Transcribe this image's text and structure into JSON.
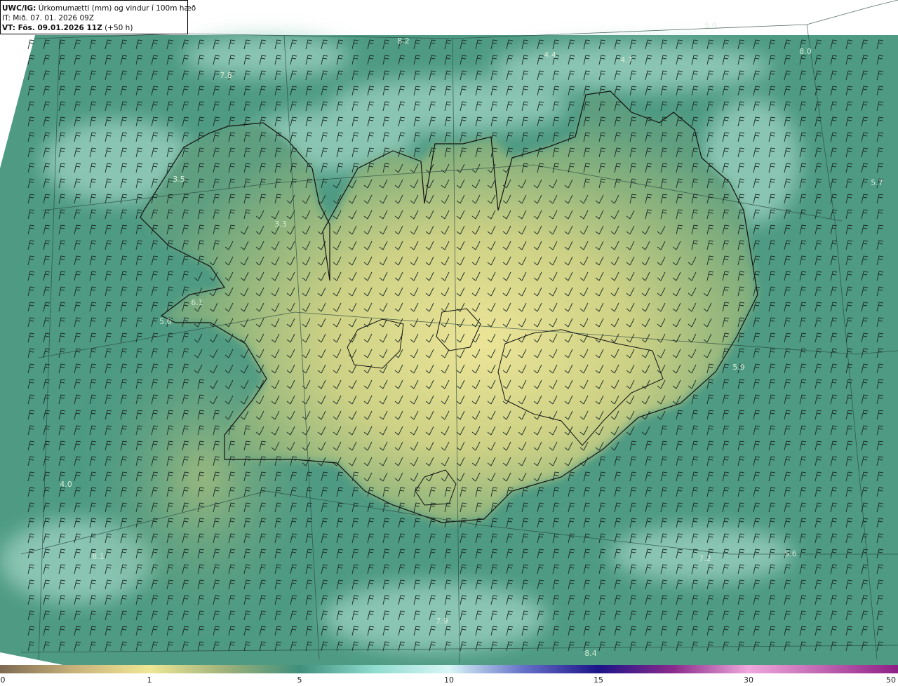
{
  "header": {
    "model_code": "UWC/IG:",
    "title_text": " Úrkomumætti (mm) og vindur í 100m hæð",
    "init_time": "IT: Mið. 07. 01. 2026 09Z",
    "valid_label": "VT: Fös. 09.01.2026 11Z",
    "valid_offset": " (+50 h)"
  },
  "map_labels": [
    {
      "text": "5.0"
    },
    {
      "text": "8.2"
    },
    {
      "text": "4.4"
    },
    {
      "text": "4.7"
    },
    {
      "text": "8.0"
    },
    {
      "text": "7.8"
    },
    {
      "text": "3.5"
    },
    {
      "text": "3.3"
    },
    {
      "text": "5.7"
    },
    {
      "text": "6.1"
    },
    {
      "text": "5.6"
    },
    {
      "text": "5.9"
    },
    {
      "text": "4.0"
    },
    {
      "text": "8.1"
    },
    {
      "text": "7.2"
    },
    {
      "text": "5.6"
    },
    {
      "text": "7.9"
    },
    {
      "text": "8.4"
    }
  ],
  "colorbar": {
    "ticks": [
      "0",
      "1",
      "5",
      "10",
      "15",
      "30",
      "50"
    ],
    "colors": {
      "low": "#7d6a52",
      "tan": "#c9b27a",
      "yellow": "#efe795",
      "teal": "#3f8f7c",
      "light_teal": "#8fdccf",
      "ice": "#d8f6f6",
      "blue": "#6570c8",
      "navy": "#1c1488",
      "purple": "#8a2a8c",
      "pink": "#f0a8dc",
      "magenta": "#8e1f86"
    }
  },
  "colors": {
    "ocean": "#4e9a83",
    "land_wet": "#6da97e",
    "land_dry": "#d4d487",
    "cloud": "#a6d8c8",
    "coast": "#111111"
  }
}
